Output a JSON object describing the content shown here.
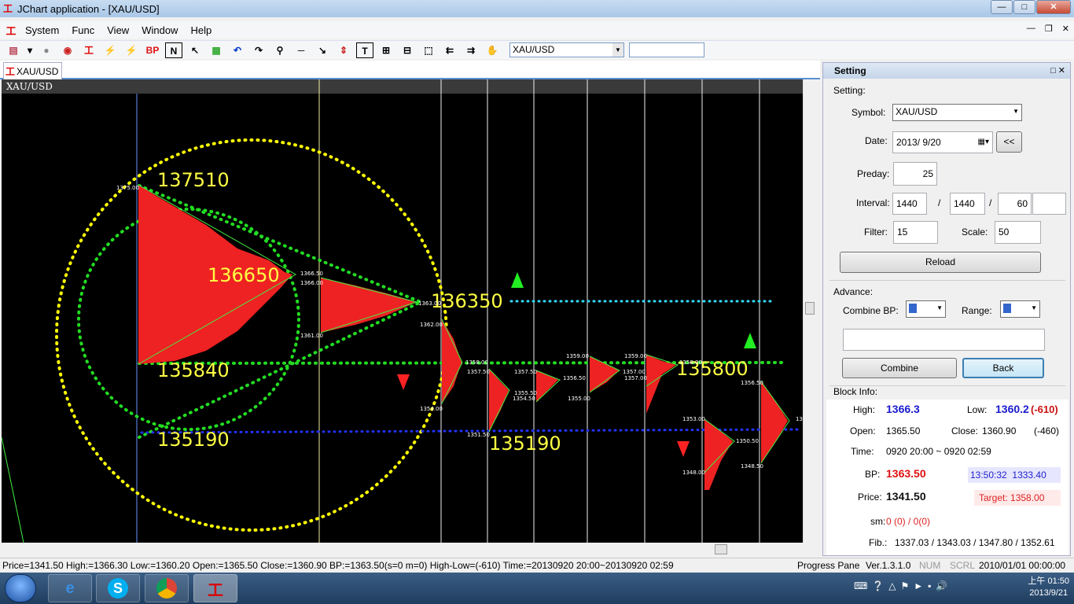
{
  "window": {
    "title": "JChart application - [XAU/USD]"
  },
  "menu": {
    "items": [
      "System",
      "Func",
      "View",
      "Window",
      "Help"
    ]
  },
  "toolbar": {
    "symbol": "XAU/USD",
    "bp_label": "BP",
    "n_label": "N",
    "t_label": "T"
  },
  "tab": {
    "label": "XAU/USD"
  },
  "chart": {
    "symbol_label": "XAU/USD",
    "big_labels": [
      "137510",
      "136650",
      "136350",
      "135840",
      "135800",
      "135190",
      "135190"
    ],
    "price_labels": [
      "1375.00",
      "1366.50",
      "1366.00",
      "1361.00",
      "1363.00",
      "1362.00",
      "1358.00",
      "1357.50",
      "1357.50",
      "1355.50",
      "1354.50",
      "1356.50",
      "1359.00",
      "1359.00",
      "1357.00",
      "1357.00",
      "1355.00",
      "1358.00",
      "1356.50",
      "1353.00",
      "1350.50",
      "1348.00",
      "1348.50",
      "1354.00",
      "1351.50",
      "1353.00"
    ],
    "colors": {
      "green": "#22dd22",
      "yellow": "#ffff00",
      "cyan": "#33ddff",
      "blue": "#2233ff",
      "profile": "#ff2222",
      "grid": "#f0f0a0"
    }
  },
  "setting": {
    "title": "Setting",
    "section_setting": "Setting:",
    "symbol_label": "Symbol:",
    "symbol_value": "XAU/USD",
    "date_label": "Date:",
    "date_value": "2013/  9/20",
    "date_prev_button": "<<",
    "preday_label": "Preday:",
    "preday_value": "25",
    "interval_label": "Interval:",
    "interval_1": "1440",
    "interval_sep": "/",
    "interval_2": "1440",
    "interval_3": "60",
    "interval_4": "",
    "filter_label": "Filter:",
    "filter_value": "15",
    "scale_label": "Scale:",
    "scale_value": "50",
    "reload_button": "Reload",
    "section_advance": "Advance:",
    "combine_bp_label": "Combine BP:",
    "range_label": "Range:",
    "combine_button": "Combine",
    "back_button": "Back",
    "section_block": "Block Info:",
    "block": {
      "high_label": "High:",
      "high_value": "1366.3",
      "low_label": "Low:",
      "low_value": "1360.2",
      "range_value": "(-610)",
      "open_label": "Open:",
      "open_value": "1365.50",
      "close_label": "Close:",
      "close_value": "1360.90",
      "close_diff": "(-460)",
      "time_label": "Time:",
      "time_value": "0920 20:00 ~ 0920 02:59",
      "bp_label": "BP:",
      "bp_value": "1363.50",
      "bp_time": "13:50:32",
      "bp_price": "1333.40",
      "price_label": "Price:",
      "price_value": "1341.50",
      "target_label": "Target:",
      "target_value": "1358.00",
      "sm_label": "sm:",
      "sm_value": "0 (0) / 0(0)",
      "fib_label": "Fib.:",
      "fib_value": "1337.03 / 1343.03 / 1347.80 / 1352.61"
    }
  },
  "status": {
    "main": "Price=1341.50  High:=1366.30  Low:=1360.20  Open:=1365.50  Close:=1360.90  BP:=1363.50(s=0 m=0)  High-Low=(-610)  Time:=20130920 20:00~20130920 02:59",
    "progress": "Progress Pane",
    "version": "Ver.1.3.1.0",
    "num": "NUM",
    "scrl": "SCRL",
    "datetime": "2010/01/01 00:00:00"
  },
  "taskbar": {
    "time": "上午 01:50",
    "date": "2013/9/21"
  }
}
